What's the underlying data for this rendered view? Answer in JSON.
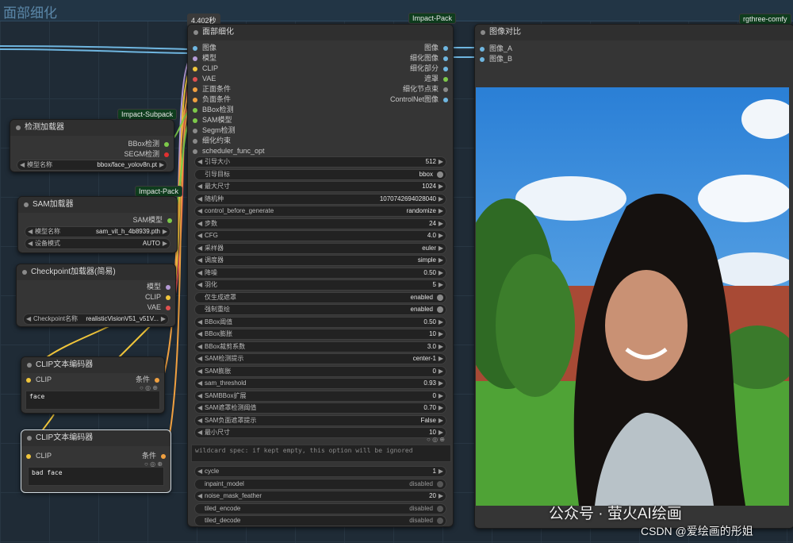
{
  "group": {
    "title": "面部细化"
  },
  "badges": {
    "timer": "4.402秒",
    "impact_pack": "Impact-Pack",
    "rgthree": "rgthree-comfy",
    "impact_subpack": "Impact-Subpack",
    "impact_pack2": "Impact-Pack"
  },
  "detailer": {
    "title": "面部细化",
    "inputs": [
      "图像",
      "模型",
      "CLIP",
      "VAE",
      "正面条件",
      "负面条件",
      "BBox检测",
      "SAM模型",
      "Segm检测",
      "细化约束",
      "scheduler_func_opt"
    ],
    "outputs": [
      "图像",
      "细化图像",
      "细化部分",
      "遮罩",
      "细化节点束",
      "ControlNet图像"
    ],
    "widgets": [
      {
        "label": "引导大小",
        "value": "512"
      },
      {
        "label": "引导目标",
        "value": "bbox"
      },
      {
        "label": "最大尺寸",
        "value": "1024"
      },
      {
        "label": "随机种",
        "value": "1070742694028040"
      },
      {
        "label": "control_before_generate",
        "value": "randomize"
      },
      {
        "label": "步数",
        "value": "24"
      },
      {
        "label": "CFG",
        "value": "4.0"
      },
      {
        "label": "采样器",
        "value": "euler"
      },
      {
        "label": "调度器",
        "value": "simple"
      },
      {
        "label": "降噪",
        "value": "0.50"
      },
      {
        "label": "羽化",
        "value": "5"
      },
      {
        "label": "仅生成遮罩",
        "value": "enabled"
      },
      {
        "label": "强制重绘",
        "value": "enabled"
      },
      {
        "label": "BBox阈值",
        "value": "0.50"
      },
      {
        "label": "BBox膨胀",
        "value": "10"
      },
      {
        "label": "BBox裁剪系数",
        "value": "3.0"
      },
      {
        "label": "SAM检测提示",
        "value": "center-1"
      },
      {
        "label": "SAM膨胀",
        "value": "0"
      },
      {
        "label": "sam_threshold",
        "value": "0.93"
      },
      {
        "label": "SAMBBox扩展",
        "value": "0"
      },
      {
        "label": "SAM遮罩检测阈值",
        "value": "0.70"
      },
      {
        "label": "SAM负面遮罩提示",
        "value": "False"
      },
      {
        "label": "最小尺寸",
        "value": "10"
      }
    ],
    "wildcard_placeholder": "wildcard spec: if kept empty, this option will be ignored",
    "extra": [
      {
        "label": "cycle",
        "value": "1"
      },
      {
        "label": "inpaint_model",
        "value": "disabled"
      },
      {
        "label": "noise_mask_feather",
        "value": "20"
      },
      {
        "label": "tiled_encode",
        "value": "disabled"
      },
      {
        "label": "tiled_decode",
        "value": "disabled"
      }
    ]
  },
  "detector": {
    "title": "检测加载器",
    "out1": "BBox检测",
    "out2": "SEGM检测",
    "model_label": "模型名称",
    "model_value": "bbox/face_yolov8n.pt"
  },
  "sam": {
    "title": "SAM加载器",
    "out": "SAM模型",
    "model_label": "模型名称",
    "model_value": "sam_vit_h_4b8939.pth",
    "device_label": "设备模式",
    "device_value": "AUTO"
  },
  "checkpoint": {
    "title": "Checkpoint加载器(简易)",
    "out1": "模型",
    "out2": "CLIP",
    "out3": "VAE",
    "ckpt_label": "Checkpoint名称",
    "ckpt_value": "realisticVisionV51_v51V..."
  },
  "clip1": {
    "title": "CLIP文本编码器",
    "in": "CLIP",
    "out": "条件",
    "text": "face"
  },
  "clip2": {
    "title": "CLIP文本编码器",
    "in": "CLIP",
    "out": "条件",
    "text": "bad face"
  },
  "compare": {
    "title": "图像对比",
    "in1": "图像_A",
    "in2": "图像_B"
  },
  "watermark": {
    "line1": "公众号 · 萤火AI绘画",
    "line2": "CSDN @爱绘画的彤姐"
  }
}
